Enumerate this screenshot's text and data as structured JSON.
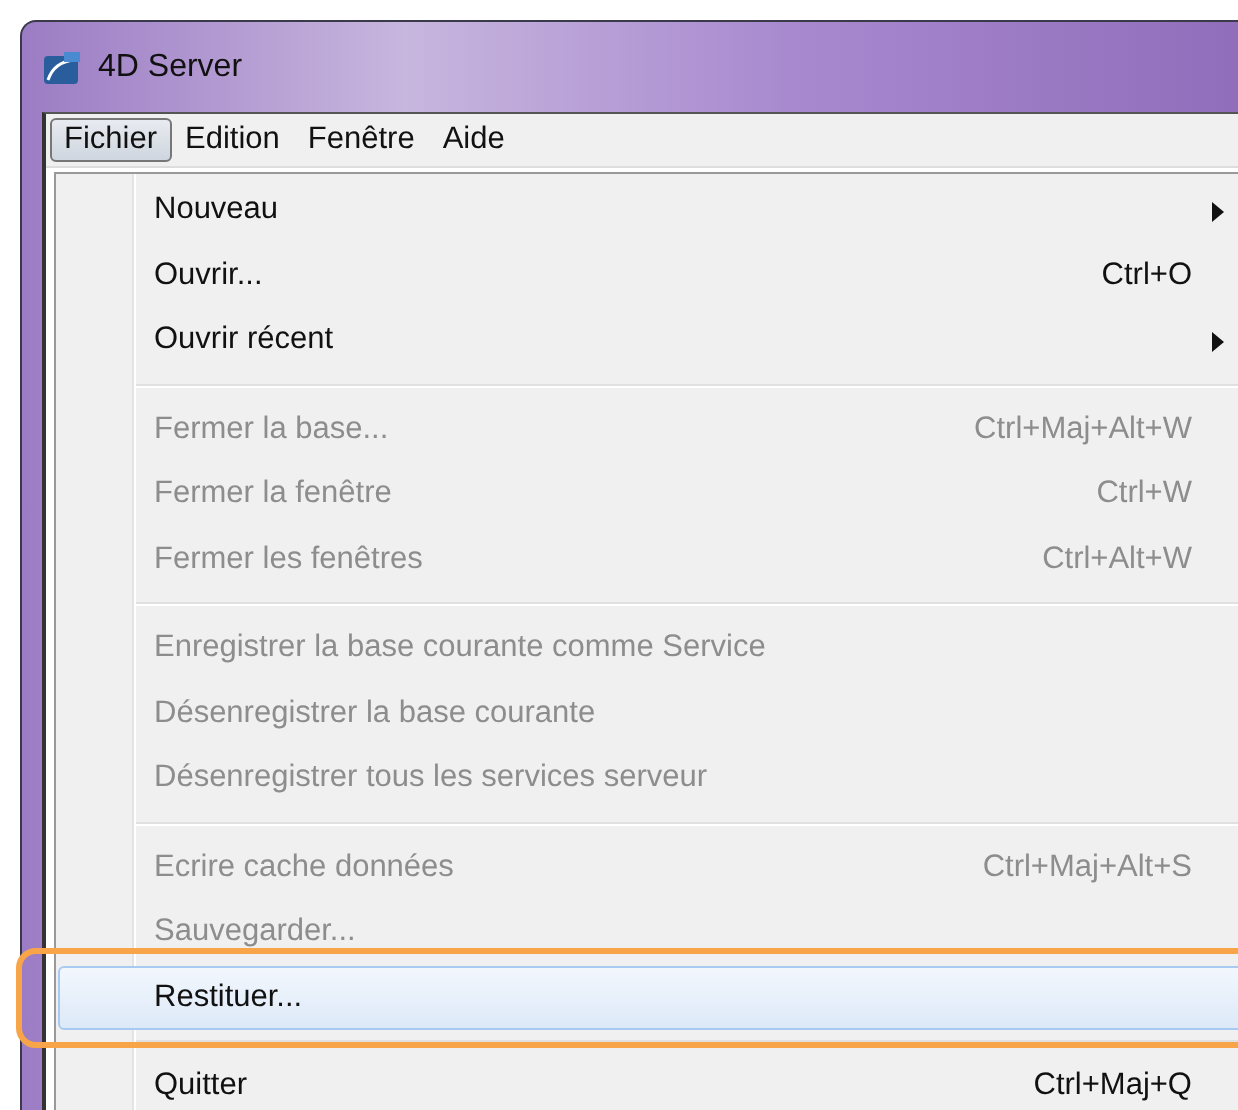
{
  "window": {
    "title": "4D Server"
  },
  "menu_bar": [
    {
      "label": "Fichier",
      "selected": true
    },
    {
      "label": "Edition",
      "selected": false
    },
    {
      "label": "Fenêtre",
      "selected": false
    },
    {
      "label": "Aide",
      "selected": false
    }
  ],
  "menu": {
    "groups": [
      [
        {
          "label": "Nouveau",
          "submenu": true,
          "disabled": false,
          "selected": false
        },
        {
          "label": "Ouvrir...",
          "shortcut": "Ctrl+O",
          "disabled": false,
          "selected": false
        },
        {
          "label": "Ouvrir récent",
          "submenu": true,
          "disabled": false,
          "selected": false
        }
      ],
      [
        {
          "label": "Fermer la base...",
          "shortcut": "Ctrl+Maj+Alt+W",
          "disabled": true,
          "selected": false
        },
        {
          "label": "Fermer la fenêtre",
          "shortcut": "Ctrl+W",
          "disabled": true,
          "selected": false
        },
        {
          "label": "Fermer les fenêtres",
          "shortcut": "Ctrl+Alt+W",
          "disabled": true,
          "selected": false
        }
      ],
      [
        {
          "label": "Enregistrer la base courante comme Service",
          "disabled": true,
          "selected": false
        },
        {
          "label": "Désenregistrer la base courante",
          "disabled": true,
          "selected": false
        },
        {
          "label": "Désenregistrer tous les services serveur",
          "disabled": true,
          "selected": false
        }
      ],
      [
        {
          "label": "Ecrire cache données",
          "shortcut": "Ctrl+Maj+Alt+S",
          "disabled": true,
          "selected": false
        },
        {
          "label": "Sauvegarder...",
          "disabled": true,
          "selected": false
        },
        {
          "label": "Restituer...",
          "disabled": false,
          "selected": true
        }
      ],
      [
        {
          "label": "Quitter",
          "shortcut": "Ctrl+Maj+Q",
          "disabled": false,
          "selected": false
        }
      ]
    ]
  },
  "highlight": {
    "kind": "outline",
    "color": "#f8a54a"
  }
}
